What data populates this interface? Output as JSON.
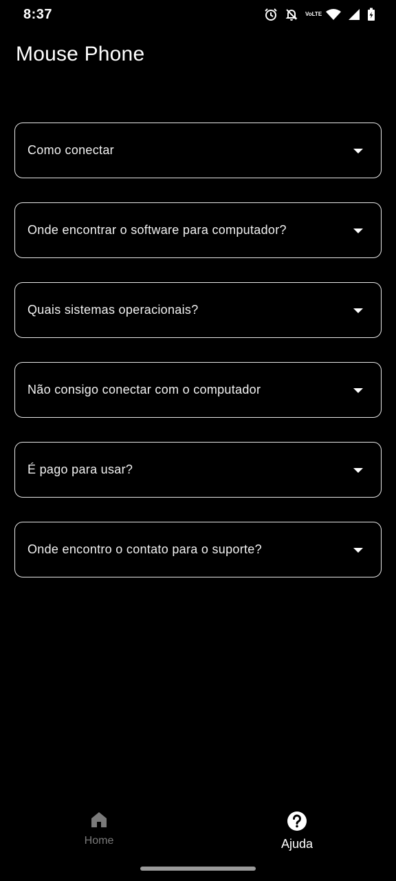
{
  "status_bar": {
    "time": "8:37",
    "icons": [
      "alarm-icon",
      "bell-off-icon",
      "volte-icon",
      "wifi-icon",
      "signal-icon",
      "battery-charging-icon"
    ],
    "volte_text_top": "Vo",
    "volte_text_bottom": "LTE"
  },
  "app": {
    "title": "Mouse Phone"
  },
  "faq": {
    "items": [
      {
        "question": "Como conectar"
      },
      {
        "question": "Onde encontrar o software para computador?"
      },
      {
        "question": "Quais sistemas operacionais?"
      },
      {
        "question": "Não consigo conectar com o computador"
      },
      {
        "question": "É pago para usar?"
      },
      {
        "question": "Onde encontro o contato para o suporte?"
      }
    ]
  },
  "bottom_nav": {
    "items": [
      {
        "label": "Home",
        "icon": "home-icon",
        "active": false
      },
      {
        "label": "Ajuda",
        "icon": "help-circle-icon",
        "active": true
      }
    ]
  },
  "colors": {
    "background": "#000000",
    "text": "#ffffff",
    "border": "#e8e8e8",
    "inactive_nav": "#7a7a7a"
  }
}
